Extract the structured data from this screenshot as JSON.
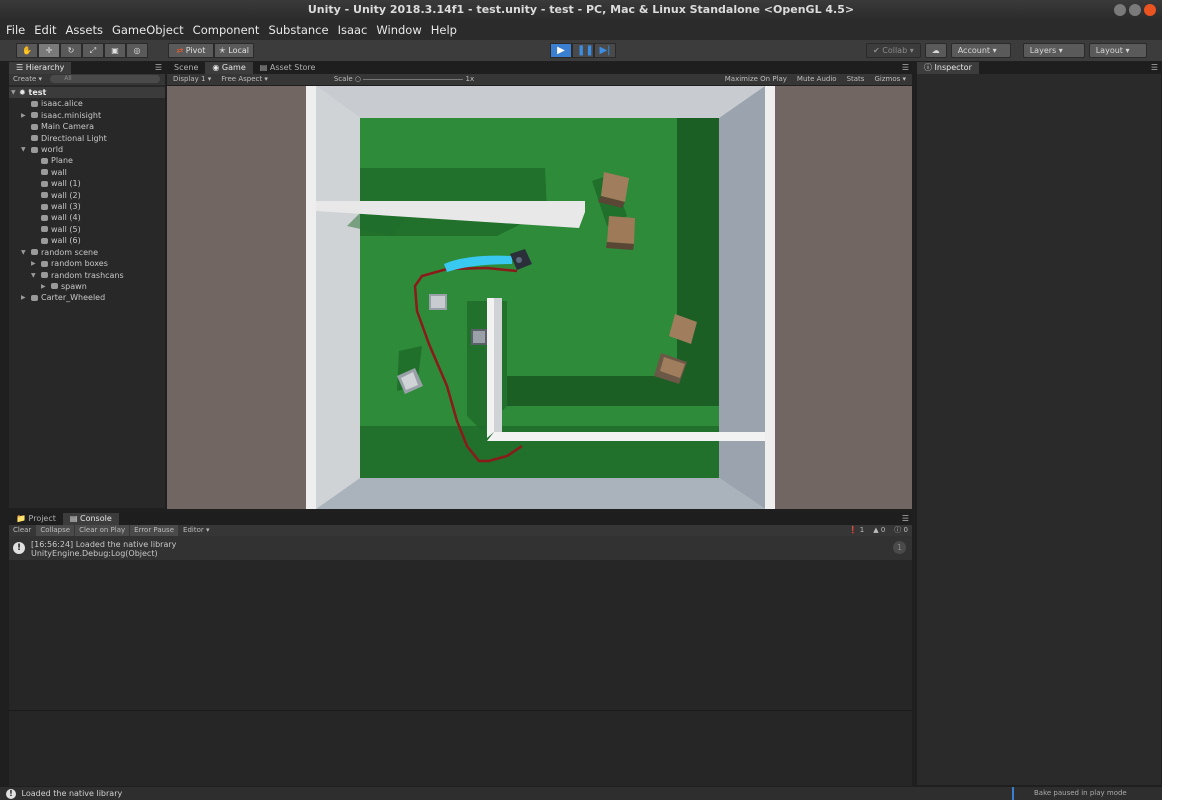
{
  "window": {
    "title": "Unity - Unity 2018.3.14f1 - test.unity - test - PC, Mac & Linux Standalone <OpenGL 4.5>"
  },
  "menu": [
    "File",
    "Edit",
    "Assets",
    "GameObject",
    "Component",
    "Substance",
    "Isaac",
    "Window",
    "Help"
  ],
  "toolbar": {
    "tools": [
      "hand-tool",
      "move-tool",
      "rotate-tool",
      "scale-tool",
      "rect-tool",
      "transform-tool"
    ],
    "pivot": "Pivot",
    "local": "Local",
    "collab": "Collab",
    "account": "Account",
    "layers": "Layers",
    "layout": "Layout"
  },
  "hierarchy": {
    "tab": "Hierarchy",
    "create": "Create",
    "search_placeholder": "All",
    "scene": "test",
    "items": [
      "isaac.alice",
      "isaac.minisight",
      "Main Camera",
      "Directional Light",
      "world",
      "Plane",
      "wall",
      "wall (1)",
      "wall (2)",
      "wall (3)",
      "wall (4)",
      "wall (5)",
      "wall (6)",
      "random scene",
      "random boxes",
      "random trashcans",
      "spawn",
      "Carter_Wheeled"
    ]
  },
  "center_tabs": {
    "scene": "Scene",
    "game": "Game",
    "asset_store": "Asset Store"
  },
  "game_toolbar": {
    "display": "Display 1",
    "aspect": "Free Aspect",
    "scale_label": "Scale",
    "scale_value": "1x",
    "maximize": "Maximize On Play",
    "mute": "Mute Audio",
    "stats": "Stats",
    "gizmos": "Gizmos"
  },
  "inspector": {
    "tab": "Inspector"
  },
  "bottom_tabs": {
    "project": "Project",
    "console": "Console"
  },
  "console": {
    "buttons": [
      "Clear",
      "Collapse",
      "Clear on Play",
      "Error Pause",
      "Editor"
    ],
    "counts": {
      "log": "1",
      "warn": "0",
      "error": "0"
    },
    "message_line1": "[16:56:24] Loaded the native library",
    "message_line2": "UnityEngine.Debug:Log(Object)"
  },
  "status": {
    "message": "Loaded the native library",
    "bake": "Bake paused in play mode"
  },
  "colors": {
    "floor": "#2e8b3a",
    "ground": "#716661",
    "accent": "#3a7fd0",
    "path": "#8b1a1a",
    "lidar": "#38c8f0"
  }
}
